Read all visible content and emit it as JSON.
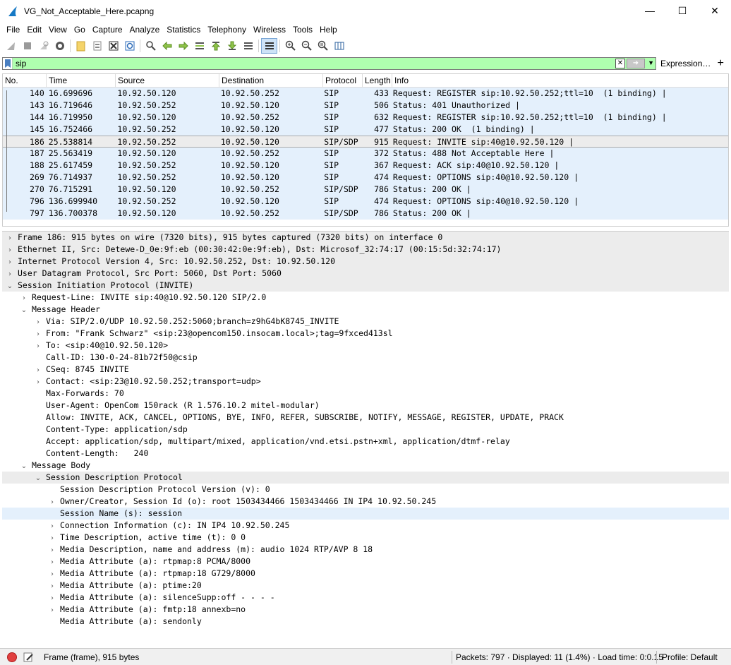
{
  "window": {
    "title": "VG_Not_Acceptable_Here.pcapng",
    "minimize": "—",
    "maximize": "☐",
    "close": "✕"
  },
  "menu": {
    "items": [
      {
        "label": "File"
      },
      {
        "label": "Edit"
      },
      {
        "label": "View"
      },
      {
        "label": "Go"
      },
      {
        "label": "Capture"
      },
      {
        "label": "Analyze"
      },
      {
        "label": "Statistics"
      },
      {
        "label": "Telephony"
      },
      {
        "label": "Wireless"
      },
      {
        "label": "Tools"
      },
      {
        "label": "Help"
      }
    ]
  },
  "filter": {
    "value": "sip",
    "expression_label": "Expression…",
    "add_label": "+",
    "color": "#afffaf"
  },
  "packet_list": {
    "columns": [
      "No.",
      "Time",
      "Source",
      "Destination",
      "Protocol",
      "Length",
      "Info"
    ],
    "rows": [
      {
        "no": "140",
        "time": "16.699696",
        "src": "10.92.50.120",
        "dst": "10.92.50.252",
        "proto": "SIP",
        "len": "433",
        "info": "Request: REGISTER sip:10.92.50.252;ttl=10  (1 binding) |"
      },
      {
        "no": "143",
        "time": "16.719646",
        "src": "10.92.50.252",
        "dst": "10.92.50.120",
        "proto": "SIP",
        "len": "506",
        "info": "Status: 401 Unauthorized |"
      },
      {
        "no": "144",
        "time": "16.719950",
        "src": "10.92.50.120",
        "dst": "10.92.50.252",
        "proto": "SIP",
        "len": "632",
        "info": "Request: REGISTER sip:10.92.50.252;ttl=10  (1 binding) |"
      },
      {
        "no": "145",
        "time": "16.752466",
        "src": "10.92.50.252",
        "dst": "10.92.50.120",
        "proto": "SIP",
        "len": "477",
        "info": "Status: 200 OK  (1 binding) |"
      },
      {
        "no": "186",
        "time": "25.538814",
        "src": "10.92.50.252",
        "dst": "10.92.50.120",
        "proto": "SIP/SDP",
        "len": "915",
        "info": "Request: INVITE sip:40@10.92.50.120 |",
        "selected": true
      },
      {
        "no": "187",
        "time": "25.563419",
        "src": "10.92.50.120",
        "dst": "10.92.50.252",
        "proto": "SIP",
        "len": "372",
        "info": "Status: 488 Not Acceptable Here |"
      },
      {
        "no": "188",
        "time": "25.617459",
        "src": "10.92.50.252",
        "dst": "10.92.50.120",
        "proto": "SIP",
        "len": "367",
        "info": "Request: ACK sip:40@10.92.50.120 |"
      },
      {
        "no": "269",
        "time": "76.714937",
        "src": "10.92.50.252",
        "dst": "10.92.50.120",
        "proto": "SIP",
        "len": "474",
        "info": "Request: OPTIONS sip:40@10.92.50.120 |"
      },
      {
        "no": "270",
        "time": "76.715291",
        "src": "10.92.50.120",
        "dst": "10.92.50.252",
        "proto": "SIP/SDP",
        "len": "786",
        "info": "Status: 200 OK |"
      },
      {
        "no": "796",
        "time": "136.699940",
        "src": "10.92.50.252",
        "dst": "10.92.50.120",
        "proto": "SIP",
        "len": "474",
        "info": "Request: OPTIONS sip:40@10.92.50.120 |"
      },
      {
        "no": "797",
        "time": "136.700378",
        "src": "10.92.50.120",
        "dst": "10.92.50.252",
        "proto": "SIP/SDP",
        "len": "786",
        "info": "Status: 200 OK |"
      }
    ],
    "row_color": "#e4f0fc"
  },
  "details": {
    "rows": [
      {
        "indent": 0,
        "arrow": "›",
        "text": "Frame 186: 915 bytes on wire (7320 bits), 915 bytes captured (7320 bits) on interface 0",
        "style": "top"
      },
      {
        "indent": 0,
        "arrow": "›",
        "text": "Ethernet II, Src: Detewe-D_0e:9f:eb (00:30:42:0e:9f:eb), Dst: Microsof_32:74:17 (00:15:5d:32:74:17)",
        "style": "top"
      },
      {
        "indent": 0,
        "arrow": "›",
        "text": "Internet Protocol Version 4, Src: 10.92.50.252, Dst: 10.92.50.120",
        "style": "top"
      },
      {
        "indent": 0,
        "arrow": "›",
        "text": "User Datagram Protocol, Src Port: 5060, Dst Port: 5060",
        "style": "top"
      },
      {
        "indent": 0,
        "arrow": "⌄",
        "text": "Session Initiation Protocol (INVITE)",
        "style": "top"
      },
      {
        "indent": 1,
        "arrow": "›",
        "text": "Request-Line: INVITE sip:40@10.92.50.120 SIP/2.0",
        "style": ""
      },
      {
        "indent": 1,
        "arrow": "⌄",
        "text": "Message Header",
        "style": ""
      },
      {
        "indent": 2,
        "arrow": "›",
        "text": "Via: SIP/2.0/UDP 10.92.50.252:5060;branch=z9hG4bK8745_INVITE",
        "style": ""
      },
      {
        "indent": 2,
        "arrow": "›",
        "text": "From: \"Frank Schwarz\" <sip:23@opencom150.insocam.local>;tag=9fxced413sl",
        "style": ""
      },
      {
        "indent": 2,
        "arrow": "›",
        "text": "To: <sip:40@10.92.50.120>",
        "style": ""
      },
      {
        "indent": 2,
        "arrow": "",
        "text": "Call-ID: 130-0-24-81b72f50@csip",
        "style": ""
      },
      {
        "indent": 2,
        "arrow": "›",
        "text": "CSeq: 8745 INVITE",
        "style": ""
      },
      {
        "indent": 2,
        "arrow": "›",
        "text": "Contact: <sip:23@10.92.50.252;transport=udp>",
        "style": ""
      },
      {
        "indent": 2,
        "arrow": "",
        "text": "Max-Forwards: 70",
        "style": ""
      },
      {
        "indent": 2,
        "arrow": "",
        "text": "User-Agent: OpenCom 150rack (R 1.576.10.2 mitel-modular)",
        "style": ""
      },
      {
        "indent": 2,
        "arrow": "",
        "text": "Allow: INVITE, ACK, CANCEL, OPTIONS, BYE, INFO, REFER, SUBSCRIBE, NOTIFY, MESSAGE, REGISTER, UPDATE, PRACK",
        "style": ""
      },
      {
        "indent": 2,
        "arrow": "",
        "text": "Content-Type: application/sdp",
        "style": ""
      },
      {
        "indent": 2,
        "arrow": "",
        "text": "Accept: application/sdp, multipart/mixed, application/vnd.etsi.pstn+xml, application/dtmf-relay",
        "style": ""
      },
      {
        "indent": 2,
        "arrow": "",
        "text": "Content-Length:   240",
        "style": ""
      },
      {
        "indent": 1,
        "arrow": "⌄",
        "text": "Message Body",
        "style": ""
      },
      {
        "indent": 2,
        "arrow": "⌄",
        "text": "Session Description Protocol",
        "style": "top"
      },
      {
        "indent": 3,
        "arrow": "",
        "text": "Session Description Protocol Version (v): 0",
        "style": ""
      },
      {
        "indent": 3,
        "arrow": "›",
        "text": "Owner/Creator, Session Id (o): root 1503434466 1503434466 IN IP4 10.92.50.245",
        "style": ""
      },
      {
        "indent": 3,
        "arrow": "",
        "text": "Session Name (s): session",
        "style": "hl"
      },
      {
        "indent": 3,
        "arrow": "›",
        "text": "Connection Information (c): IN IP4 10.92.50.245",
        "style": ""
      },
      {
        "indent": 3,
        "arrow": "›",
        "text": "Time Description, active time (t): 0 0",
        "style": ""
      },
      {
        "indent": 3,
        "arrow": "›",
        "text": "Media Description, name and address (m): audio 1024 RTP/AVP 8 18",
        "style": ""
      },
      {
        "indent": 3,
        "arrow": "›",
        "text": "Media Attribute (a): rtpmap:8 PCMA/8000",
        "style": ""
      },
      {
        "indent": 3,
        "arrow": "›",
        "text": "Media Attribute (a): rtpmap:18 G729/8000",
        "style": ""
      },
      {
        "indent": 3,
        "arrow": "›",
        "text": "Media Attribute (a): ptime:20",
        "style": ""
      },
      {
        "indent": 3,
        "arrow": "›",
        "text": "Media Attribute (a): silenceSupp:off - - - -",
        "style": ""
      },
      {
        "indent": 3,
        "arrow": "›",
        "text": "Media Attribute (a): fmtp:18 annexb=no",
        "style": ""
      },
      {
        "indent": 3,
        "arrow": "",
        "text": "Media Attribute (a): sendonly",
        "style": ""
      }
    ]
  },
  "status": {
    "frame_text": "Frame (frame), 915 bytes",
    "packets_text": "Packets: 797 · Displayed: 11 (1.4%) · Load time: 0:0.15",
    "profile_text": "Profile: Default"
  }
}
